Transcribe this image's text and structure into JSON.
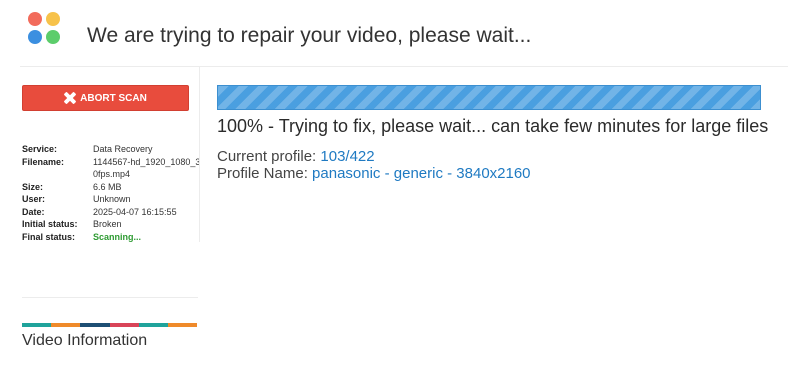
{
  "header": {
    "title": "We are trying to repair your video, please wait..."
  },
  "sidebar": {
    "abort_label": "ABORT SCAN",
    "info": [
      {
        "label": "Service:",
        "value": "Data Recovery"
      },
      {
        "label": "Filename:",
        "value": "1144567-hd_1920_1080_30fps.mp4"
      },
      {
        "label": "Size:",
        "value": "6.6 MB"
      },
      {
        "label": "User:",
        "value": "Unknown"
      },
      {
        "label": "Date:",
        "value": "2025-04-07 16:15:55"
      },
      {
        "label": "Initial status:",
        "value": "Broken"
      },
      {
        "label": "Final status:",
        "value": "Scanning..."
      }
    ],
    "color_bar": [
      "#1fa39b",
      "#ef8a2a",
      "#1d4e73",
      "#d94458",
      "#1fa39b",
      "#ef8a2a"
    ],
    "video_info_title": "Video Information"
  },
  "main": {
    "progress_percent": 100,
    "status_text": "100% - Trying to fix, please wait... can take few minutes for large files",
    "current_profile_label": "Current profile:",
    "current_profile_value": "103/422",
    "profile_name_label": "Profile Name:",
    "profile_name_value": "panasonic - generic - 3840x2160"
  },
  "colors": {
    "accent": "#3b8fe0",
    "danger": "#e84c3d",
    "success": "#2e9b32",
    "link": "#1f7ac2"
  }
}
